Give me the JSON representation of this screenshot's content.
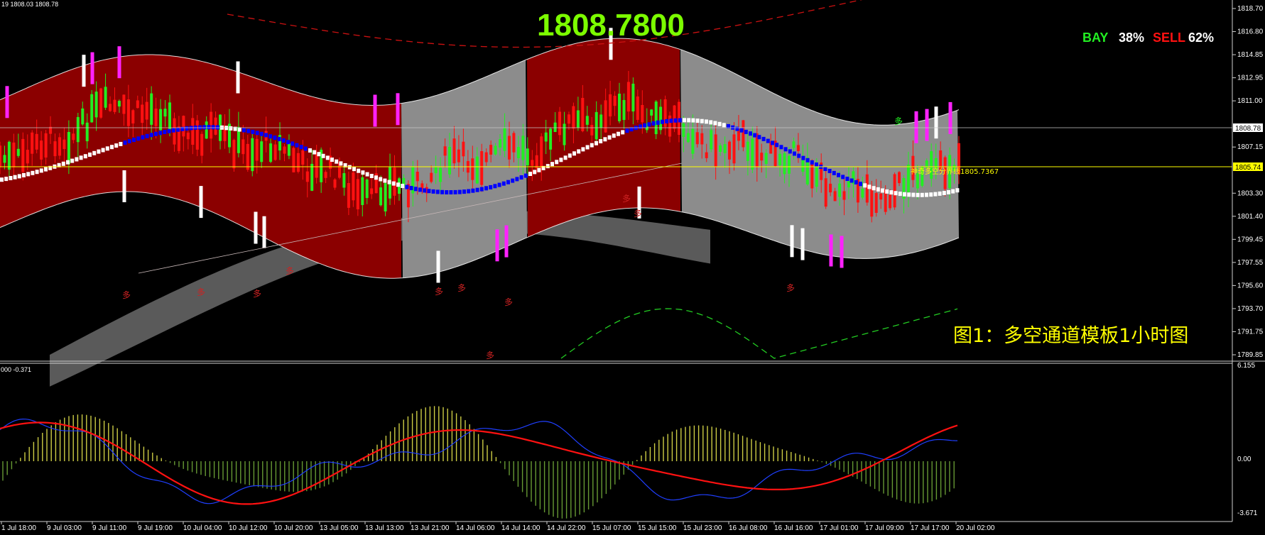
{
  "header": {
    "info": "19 1808.03 1808.78",
    "big_price": "1808.7800",
    "bay_label": "BAY",
    "bay_pct": "38%",
    "sell_label": "SELL",
    "sell_pct": "62%"
  },
  "caption": "图1：多空通道模板1小时图",
  "line_label": "神奇多空分界线1805.7367",
  "price_axis": {
    "ticks": [
      "1818.70",
      "1816.80",
      "1814.85",
      "1812.95",
      "1811.00",
      "1808.78",
      "1807.15",
      "1805.74",
      "1803.30",
      "1801.40",
      "1799.45",
      "1797.55",
      "1795.60",
      "1793.70",
      "1791.75",
      "1789.85"
    ],
    "current": "1808.78",
    "boundary": "1805.74"
  },
  "osc": {
    "info": "000 -0.371",
    "axis_ticks": [
      "6.155",
      "0.00",
      "-3.671"
    ]
  },
  "time_axis": [
    "1 Jul 18:00",
    "9 Jul 03:00",
    "9 Jul 11:00",
    "9 Jul 19:00",
    "10 Jul 04:00",
    "10 Jul 12:00",
    "10 Jul 20:00",
    "13 Jul 05:00",
    "13 Jul 13:00",
    "13 Jul 21:00",
    "14 Jul 06:00",
    "14 Jul 14:00",
    "14 Jul 22:00",
    "15 Jul 07:00",
    "15 Jul 15:00",
    "15 Jul 23:00",
    "16 Jul 08:00",
    "16 Jul 16:00",
    "17 Jul 01:00",
    "17 Jul 09:00",
    "17 Jul 17:00",
    "20 Jul 02:00"
  ],
  "marker_char": "多",
  "colors": {
    "bull": "#22ee22",
    "bear": "#ff1111",
    "magenta": "#ff22ff",
    "white": "#ffffff",
    "blue": "#0000ff",
    "band_red": "#8b0000",
    "band_gray": "#8c8c8c",
    "yellow": "#ffff00",
    "lime": "#7cfc00"
  },
  "chart_data": {
    "type": "candlestick",
    "timeframe": "1 hour",
    "current_price": 1808.78,
    "boundary_line": 1805.7367,
    "ylim": [
      1789.85,
      1818.7
    ],
    "bay_pct": 38,
    "sell_pct": 62,
    "oscillator_ylim": [
      -3.671,
      6.155
    ],
    "oscillator_last": -0.371
  }
}
